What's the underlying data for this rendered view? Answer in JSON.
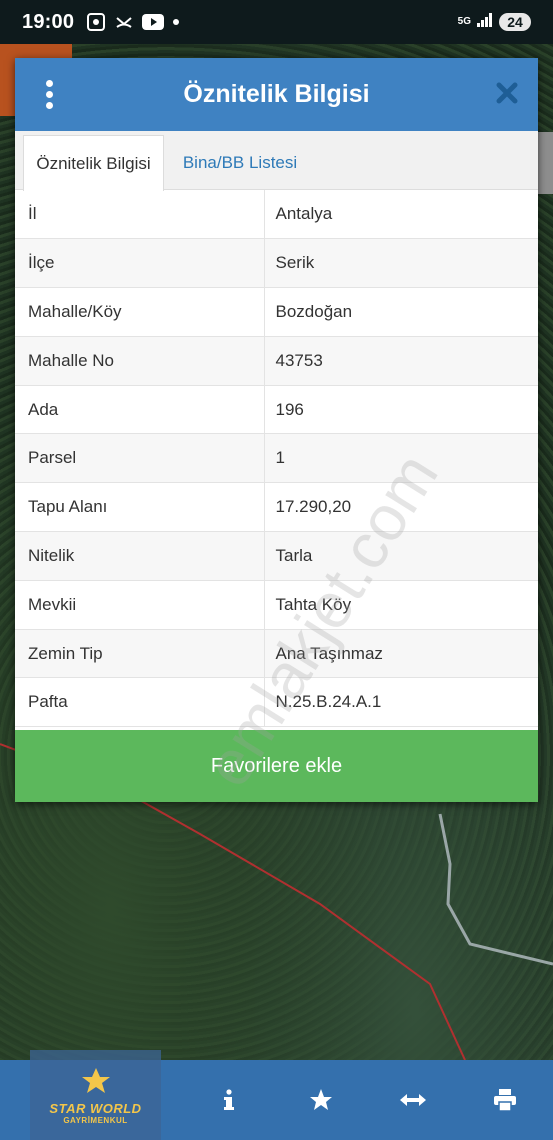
{
  "status_bar": {
    "time": "19:00",
    "network": "5G",
    "battery": "24"
  },
  "dialog": {
    "title": "Öznitelik Bilgisi",
    "tabs": [
      {
        "label": "Öznitelik Bilgisi",
        "active": true
      },
      {
        "label": "Bina/BB Listesi",
        "active": false
      }
    ],
    "rows": [
      {
        "key": "İl",
        "value": "Antalya"
      },
      {
        "key": "İlçe",
        "value": "Serik"
      },
      {
        "key": "Mahalle/Köy",
        "value": "Bozdoğan"
      },
      {
        "key": "Mahalle No",
        "value": "43753"
      },
      {
        "key": "Ada",
        "value": "196"
      },
      {
        "key": "Parsel",
        "value": "1"
      },
      {
        "key": "Tapu Alanı",
        "value": "17.290,20"
      },
      {
        "key": "Nitelik",
        "value": "Tarla"
      },
      {
        "key": "Mevkii",
        "value": "Tahta Köy"
      },
      {
        "key": "Zemin Tip",
        "value": "Ana Taşınmaz"
      },
      {
        "key": "Pafta",
        "value": "N.25.B.24.A.1"
      }
    ],
    "favorite_button": "Favorilere ekle"
  },
  "watermark": "emlakjet.com",
  "logo": {
    "line1": "STAR WORLD",
    "line2": "GAYRİMENKUL"
  },
  "toolbar": {
    "icons": [
      "info-icon",
      "star-icon",
      "arrows-horizontal-icon",
      "print-icon"
    ]
  },
  "colors": {
    "header": "#3f82c2",
    "favorite_button": "#5cb85c",
    "toolbar": "#3470ad",
    "tab_link": "#2e7ab8"
  }
}
